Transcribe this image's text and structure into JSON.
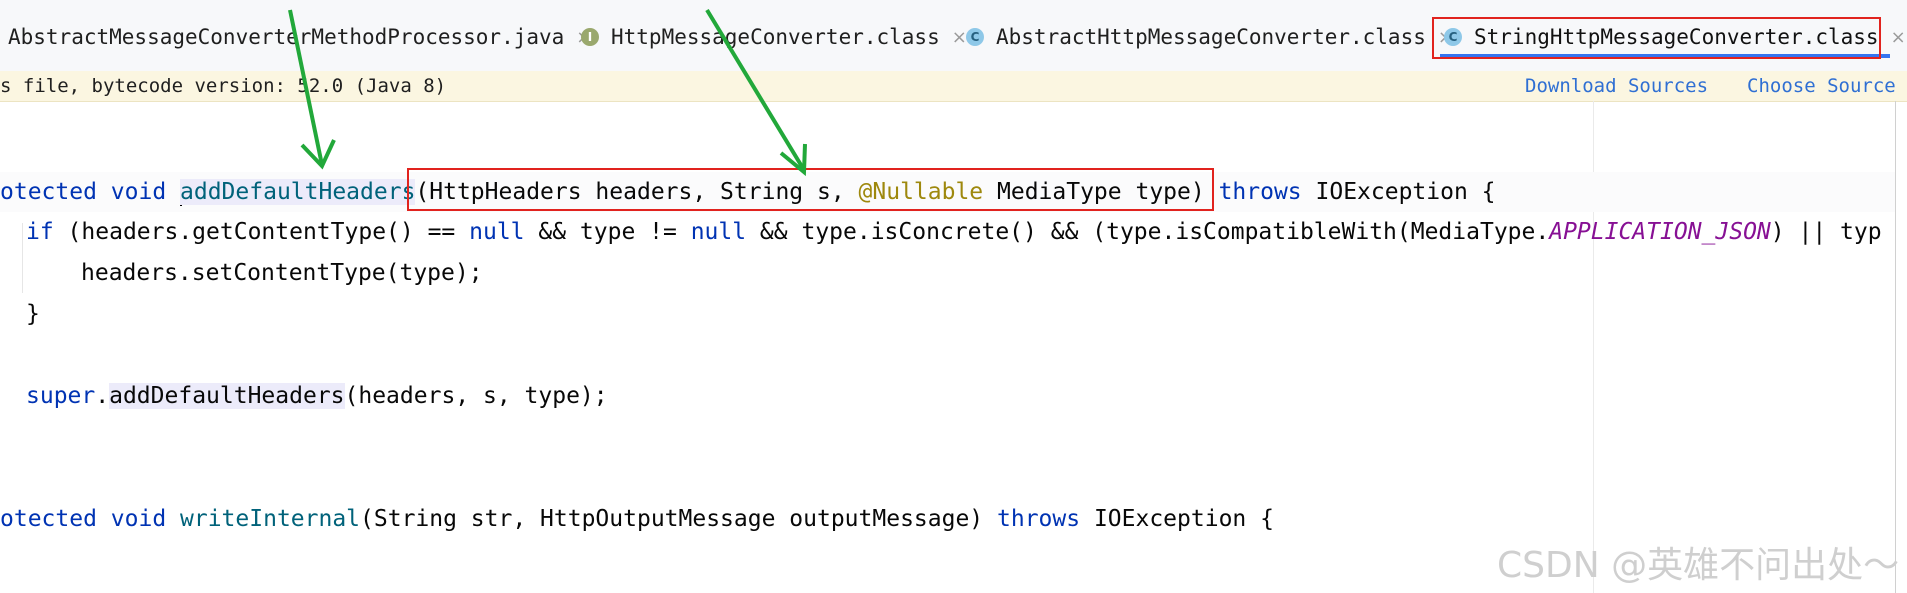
{
  "tabs": [
    {
      "label": "AbstractMessageConverterMethodProcessor.java",
      "icon": "java-file-icon",
      "type": ""
    },
    {
      "label": "HttpMessageConverter.class",
      "icon": "interface-icon",
      "type": "I"
    },
    {
      "label": "AbstractHttpMessageConverter.class",
      "icon": "class-icon",
      "type": "C"
    },
    {
      "label": "StringHttpMessageConverter.class",
      "icon": "class-icon",
      "type": "C",
      "active": true
    }
  ],
  "close_glyph": "×",
  "banner": {
    "message": "s file, bytecode version: 52.0 (Java 8)",
    "download_sources": "Download Sources",
    "choose_source": "Choose Source"
  },
  "code": {
    "l1": {
      "kw1": "otected void ",
      "name": "addDefaultHeaders",
      "params": "(HttpHeaders headers, String s, ",
      "ann": "@Nullable",
      "params2": " MediaType type)",
      "kw2": " throws",
      "rest": " IOException {"
    },
    "l2": {
      "kw_if": "if",
      "a": " (headers.getContentType() == ",
      "kw_null1": "null",
      "b": " && type != ",
      "kw_null2": "null",
      "c": " && type.isConcrete() && (type.isCompatibleWith(MediaType.",
      "const": "APPLICATION_JSON",
      "d": ") || typ"
    },
    "l3": {
      "text": "headers.setContentType(type);"
    },
    "l4": {
      "text": "}"
    },
    "l5": {
      "kw_super": "super",
      "dot": ".",
      "call": "addDefaultHeaders",
      "args": "(headers, s, type);"
    },
    "l6": {
      "kw1": "otected void ",
      "name": "writeInternal",
      "params": "(String str, HttpOutputMessage outputMessage)",
      "kw2": " throws",
      "rest": " IOException {"
    }
  },
  "watermark": "CSDN @英雄不问出处～"
}
